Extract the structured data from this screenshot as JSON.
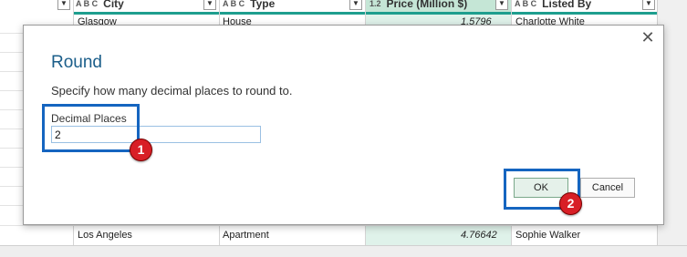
{
  "grid": {
    "headers": [
      {
        "type_icon": "",
        "label": ""
      },
      {
        "type_icon": "A B C",
        "label": "City"
      },
      {
        "type_icon": "A B C",
        "label": "Type"
      },
      {
        "type_icon": "1.2",
        "label": "Price (Million $)"
      },
      {
        "type_icon": "A B C",
        "label": "Listed By"
      }
    ],
    "top_row": {
      "city": "Glasgow",
      "type": "House",
      "price": "1.5796",
      "listed_by": "Charlotte White"
    },
    "bottom_row": {
      "city": "Los Angeles",
      "type": "Apartment",
      "price": "4.76642",
      "listed_by": "Sophie Walker"
    },
    "dropdown_glyph": "▼"
  },
  "dialog": {
    "title": "Round",
    "close_glyph": "✕",
    "description": "Specify how many decimal places to round to.",
    "field_label": "Decimal Places",
    "field_value": "2",
    "ok_label": "OK",
    "cancel_label": "Cancel"
  },
  "callouts": {
    "step1": "1",
    "step2": "2",
    "highlight_color": "#1565c0",
    "badge_color": "#d81f26"
  }
}
